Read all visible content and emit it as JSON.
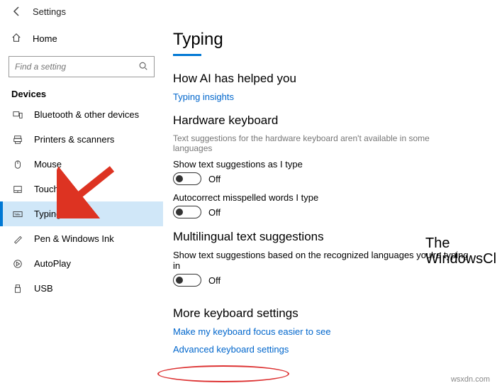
{
  "titlebar": {
    "label": "Settings"
  },
  "sidebar": {
    "home": "Home",
    "search_placeholder": "Find a setting",
    "group_header": "Devices",
    "items": [
      {
        "label": "Bluetooth & other devices"
      },
      {
        "label": "Printers & scanners"
      },
      {
        "label": "Mouse"
      },
      {
        "label": "Touchpad"
      },
      {
        "label": "Typing"
      },
      {
        "label": "Pen & Windows Ink"
      },
      {
        "label": "AutoPlay"
      },
      {
        "label": "USB"
      }
    ]
  },
  "content": {
    "page_title": "Typing",
    "sections": {
      "ai": {
        "header": "How AI has helped you",
        "link": "Typing insights"
      },
      "hardware": {
        "header": "Hardware keyboard",
        "desc": "Text suggestions for the hardware keyboard aren't available in some languages",
        "set1_label": "Show text suggestions as I type",
        "set1_state": "Off",
        "set2_label": "Autocorrect misspelled words I type",
        "set2_state": "Off"
      },
      "multi": {
        "header": "Multilingual text suggestions",
        "set1_label": "Show text suggestions based on the recognized languages you're typing in",
        "set1_state": "Off"
      },
      "more": {
        "header": "More keyboard settings",
        "link1": "Make my keyboard focus easier to see",
        "link2": "Advanced keyboard settings"
      }
    }
  },
  "watermark": {
    "line1": "The",
    "line2": "WindowsClub"
  },
  "attribution": "wsxdn.com"
}
